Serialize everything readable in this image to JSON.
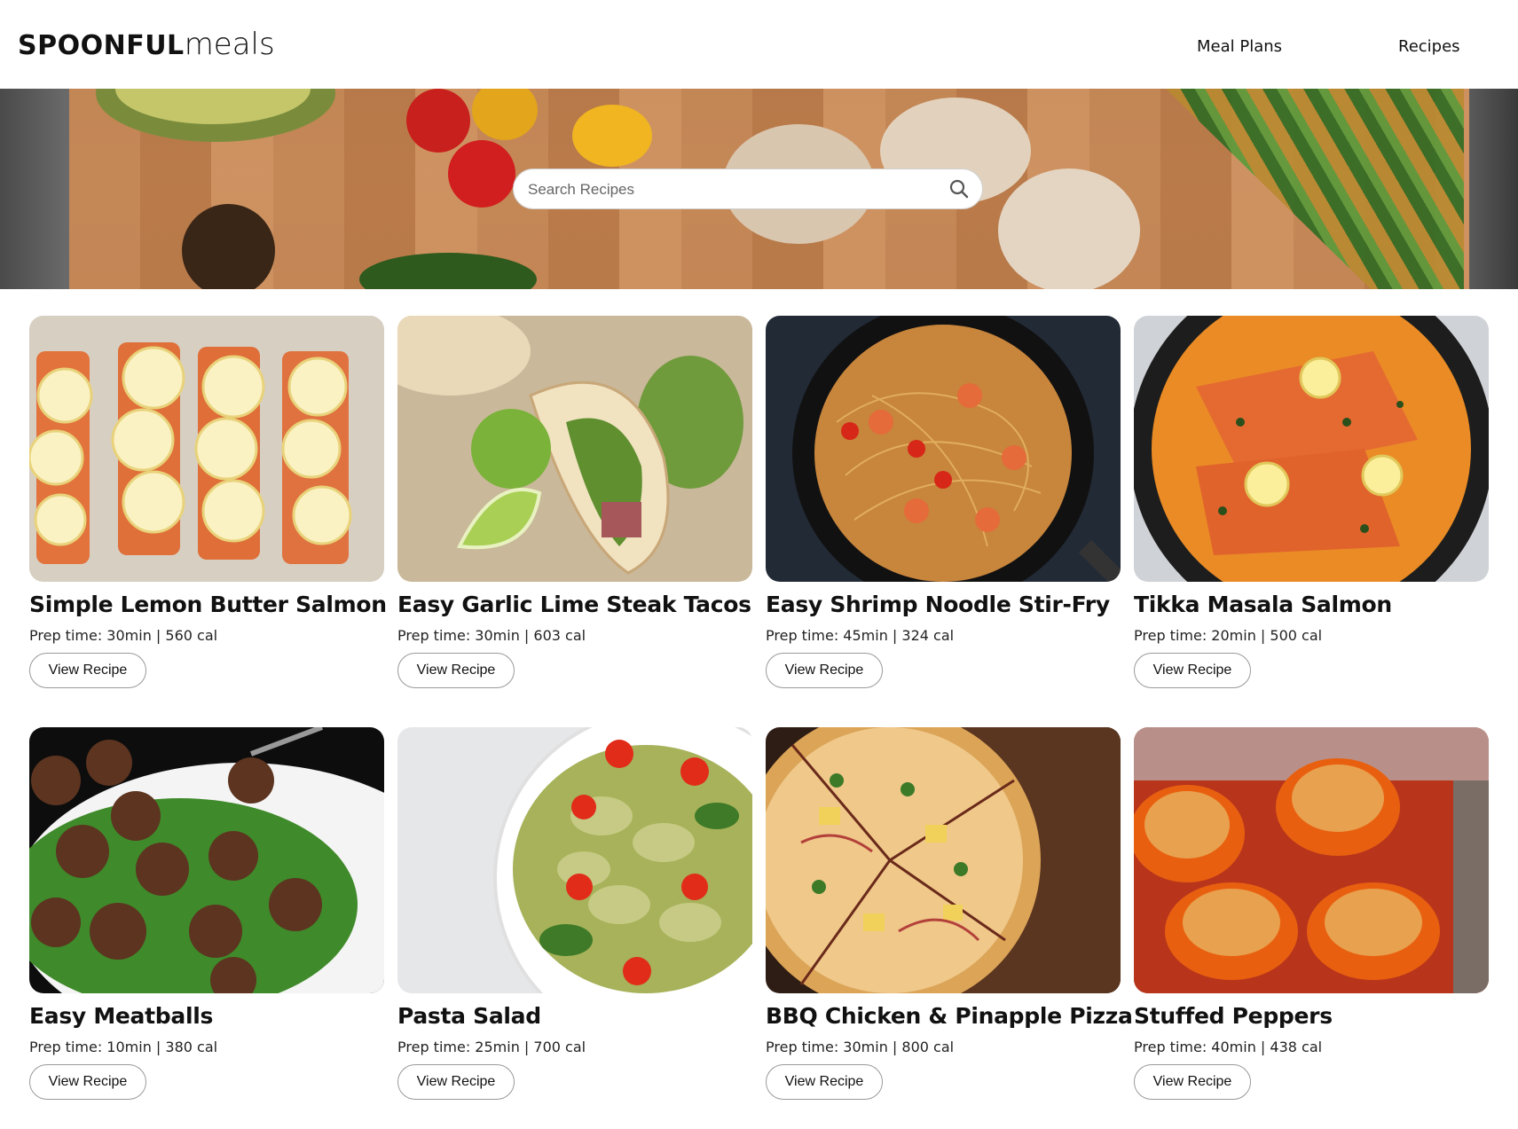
{
  "header": {
    "logo_bold": "SPOONFUL",
    "logo_light": "meals",
    "nav": [
      {
        "label": "Meal Plans"
      },
      {
        "label": "Recipes"
      }
    ]
  },
  "search": {
    "placeholder": "Search Recipes",
    "icon": "search-icon"
  },
  "colors": {
    "accent": "#111111",
    "button_border": "#999999",
    "page_background": "#ffffff"
  },
  "recipes": [
    {
      "title": "Simple Lemon Butter Salmon",
      "meta": "Prep time: 30min | 560 cal",
      "button": "View Recipe"
    },
    {
      "title": "Easy Garlic Lime Steak Tacos",
      "meta": "Prep time: 30min | 603 cal",
      "button": "View Recipe"
    },
    {
      "title": "Easy Shrimp Noodle Stir-Fry",
      "meta": "Prep time: 45min | 324 cal",
      "button": "View Recipe"
    },
    {
      "title": "Tikka Masala Salmon",
      "meta": "Prep time: 20min | 500 cal",
      "button": "View Recipe"
    },
    {
      "title": "Easy Meatballs",
      "meta": "Prep time: 10min | 380 cal",
      "button": "View Recipe"
    },
    {
      "title": "Pasta Salad",
      "meta": "Prep time: 25min | 700 cal",
      "button": "View Recipe"
    },
    {
      "title": "BBQ Chicken & Pinapple Pizza",
      "meta": "Prep time: 30min | 800 cal",
      "button": "View Recipe"
    },
    {
      "title": "Stuffed Peppers",
      "meta": "Prep time: 40min | 438 cal",
      "button": "View Recipe"
    }
  ]
}
